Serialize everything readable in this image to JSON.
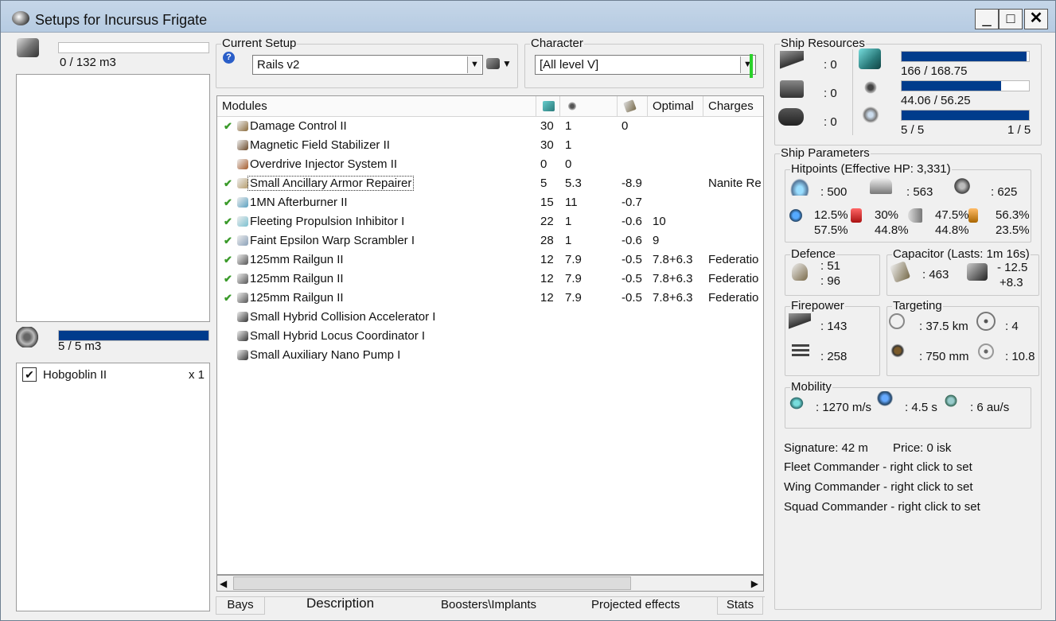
{
  "window": {
    "title": "Setups for Incursus Frigate",
    "buttons": {
      "minimize": "_",
      "maximize": "□",
      "close": "✕"
    }
  },
  "cargo": {
    "capacity_text": "0 / 132 m3"
  },
  "drone_bay": {
    "capacity_text": "5 / 5 m3",
    "fill": 1.0,
    "drones": [
      {
        "name": "Hobgoblin II",
        "qty": "x 1",
        "checked": true
      }
    ]
  },
  "current_setup": {
    "group_label": "Current Setup",
    "value": "Rails v2",
    "help_icon": "?"
  },
  "character": {
    "group_label": "Character",
    "value": "[All level V]"
  },
  "modules_table": {
    "headers": [
      "Modules",
      "",
      "",
      "",
      "Optimal",
      "Charges"
    ],
    "rows": [
      {
        "check": "✔",
        "name": "Damage Control II",
        "cpu": "30",
        "pg": "1",
        "cap": "0",
        "optimal": "",
        "charge": ""
      },
      {
        "check": "",
        "name": "Magnetic Field Stabilizer II",
        "cpu": "30",
        "pg": "1",
        "cap": "",
        "optimal": "",
        "charge": ""
      },
      {
        "check": "",
        "name": "Overdrive Injector System II",
        "cpu": "0",
        "pg": "0",
        "cap": "",
        "optimal": "",
        "charge": ""
      },
      {
        "check": "✔",
        "name": "Small Ancillary Armor Repairer",
        "cpu": "5",
        "pg": "5.3",
        "cap": "-8.9",
        "optimal": "",
        "charge": "Nanite Re"
      },
      {
        "check": "✔",
        "name": "1MN Afterburner II",
        "cpu": "15",
        "pg": "11",
        "cap": "-0.7",
        "optimal": "",
        "charge": ""
      },
      {
        "check": "✔",
        "name": "Fleeting Propulsion Inhibitor I",
        "cpu": "22",
        "pg": "1",
        "cap": "-0.6",
        "optimal": "10",
        "charge": ""
      },
      {
        "check": "✔",
        "name": "Faint Epsilon Warp Scrambler I",
        "cpu": "28",
        "pg": "1",
        "cap": "-0.6",
        "optimal": "9",
        "charge": ""
      },
      {
        "check": "✔",
        "name": "125mm Railgun II",
        "cpu": "12",
        "pg": "7.9",
        "cap": "-0.5",
        "optimal": "7.8+6.3",
        "charge": "Federatio"
      },
      {
        "check": "✔",
        "name": "125mm Railgun II",
        "cpu": "12",
        "pg": "7.9",
        "cap": "-0.5",
        "optimal": "7.8+6.3",
        "charge": "Federatio"
      },
      {
        "check": "✔",
        "name": "125mm Railgun II",
        "cpu": "12",
        "pg": "7.9",
        "cap": "-0.5",
        "optimal": "7.8+6.3",
        "charge": "Federatio"
      },
      {
        "check": "",
        "name": "Small Hybrid Collision Accelerator I",
        "cpu": "",
        "pg": "",
        "cap": "",
        "optimal": "",
        "charge": ""
      },
      {
        "check": "",
        "name": "Small Hybrid Locus Coordinator I",
        "cpu": "",
        "pg": "",
        "cap": "",
        "optimal": "",
        "charge": ""
      },
      {
        "check": "",
        "name": "Small Auxiliary Nano Pump I",
        "cpu": "",
        "pg": "",
        "cap": "",
        "optimal": "",
        "charge": ""
      }
    ]
  },
  "bottom_tabs": [
    "Bays",
    "Description",
    "Boosters\\Implants",
    "Projected effects",
    "Stats"
  ],
  "ship_resources": {
    "group_label": "Ship Resources",
    "turrets": ": 0",
    "launchers": ": 0",
    "calibration": ": 0",
    "cpu": {
      "text": "166 / 168.75",
      "fill": 0.984
    },
    "powergrid": {
      "text": "44.06 / 56.25",
      "fill": 0.783
    },
    "drones": {
      "left": "5 / 5",
      "right": "1 / 5",
      "fill": 1.0
    }
  },
  "ship_parameters": {
    "group_label": "Ship Parameters",
    "hitpoints": {
      "label": "Hitpoints (Effective HP: 3,331)",
      "shield": ": 500",
      "armor": ": 563",
      "hull": ": 625",
      "resists": [
        {
          "top": "12.5%",
          "bottom": "57.5%"
        },
        {
          "top": "30%",
          "bottom": "44.8%"
        },
        {
          "top": "47.5%",
          "bottom": "44.8%"
        },
        {
          "top": "56.3%",
          "bottom": "23.5%"
        }
      ]
    },
    "defence": {
      "label": "Defence",
      "top": ": 51",
      "bottom": ": 96"
    },
    "capacitor": {
      "label": "Capacitor (Lasts: 1m 16s)",
      "amount": ": 463",
      "top": "- 12.5",
      "bottom": "+8.3"
    },
    "firepower": {
      "label": "Firepower",
      "turret": ": 143",
      "volley": ": 258"
    },
    "targeting": {
      "label": "Targeting",
      "range": ": 37.5 km",
      "targets": ": 4",
      "sig_res": ": 750 mm",
      "sensor": ": 10.8"
    },
    "mobility": {
      "label": "Mobility",
      "speed": ": 1270 m/s",
      "align": ": 4.5 s",
      "warp": ": 6 au/s"
    },
    "signature": "Signature: 42 m",
    "price": "Price: 0 isk",
    "fleet_commander": "Fleet Commander - right click to set",
    "wing_commander": "Wing Commander - right click to set",
    "squad_commander": "Squad Commander - right click to set"
  }
}
